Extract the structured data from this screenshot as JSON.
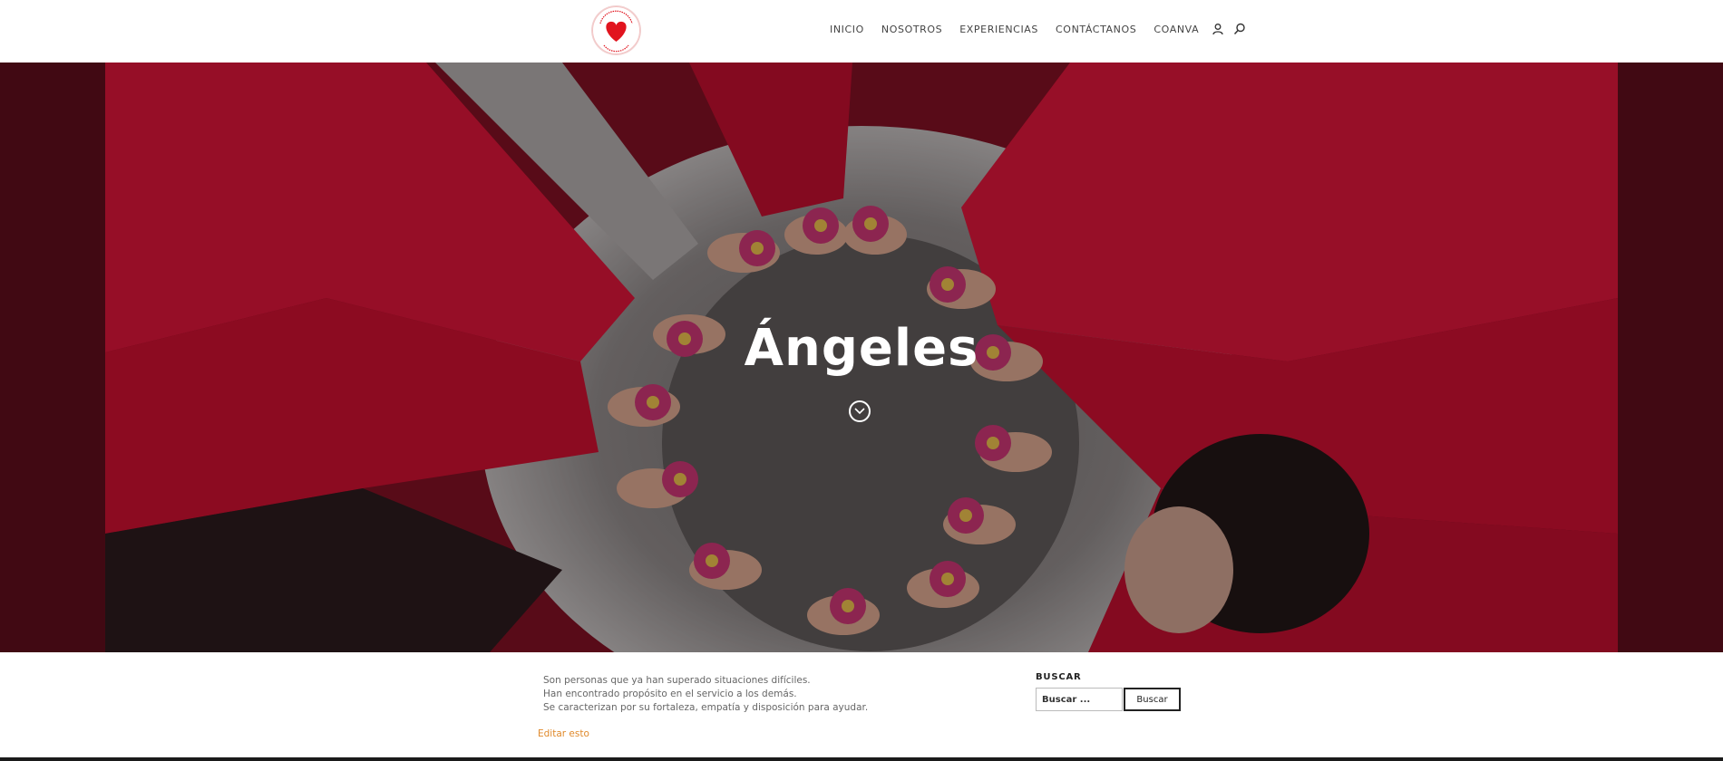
{
  "brand": {
    "logo_alt": "Angeles de Compassion logo",
    "accent_color": "#e1141e"
  },
  "nav": {
    "items": [
      {
        "label": "INICIO"
      },
      {
        "label": "NOSOTROS"
      },
      {
        "label": "EXPERIENCIAS"
      },
      {
        "label": "CONTÁCTANOS"
      },
      {
        "label": "COANVA"
      }
    ],
    "account_icon": "user-icon",
    "search_icon": "search-icon"
  },
  "hero": {
    "title": "Ángeles",
    "scroll_icon": "chevron-down-icon"
  },
  "content": {
    "lines": [
      "Son personas que ya han superado situaciones difíciles.",
      "Han encontrado propósito en el servicio a los demás.",
      "Se caracterizan por su fortaleza, empatía y disposición para ayudar."
    ],
    "edit_link": "Editar esto"
  },
  "search": {
    "heading": "BUSCAR",
    "placeholder": "Buscar ...",
    "button": "Buscar"
  }
}
